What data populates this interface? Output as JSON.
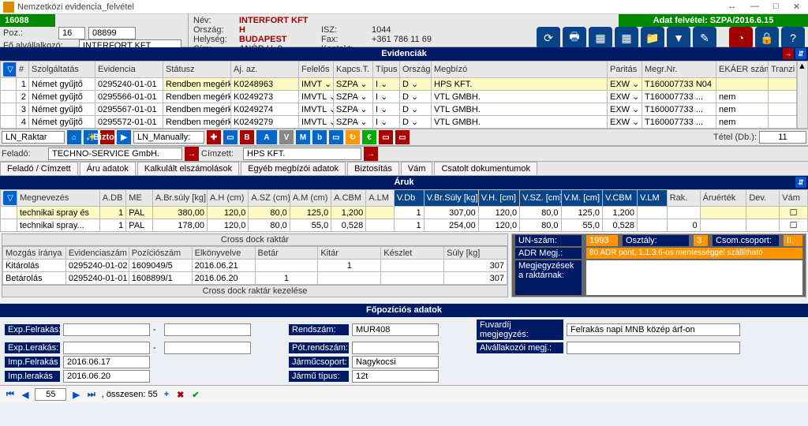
{
  "window": {
    "title": "Nemzetközi evidencia_felvétel",
    "param": "16088",
    "min": "—",
    "max": "□",
    "close": "✕",
    "up": "↔"
  },
  "header": {
    "posLbl": "Poz.:",
    "pos1": "16",
    "pos2": "08899",
    "foLbl": "Fő alvállalkozó:",
    "fo": "INTERFORT KFT",
    "info": {
      "nev": "Név:",
      "nevV": "INTERFORT KFT",
      "orszag": "Ország:",
      "orszagV": "H",
      "isz": "ISZ:",
      "iszV": "1044",
      "hely": "Helység:",
      "helyV": "BUDAPEST",
      "fax": "Fax:",
      "faxV": "+361 786 11 69",
      "cim": "Cím:",
      "cimV": "ANÓD U. 9.",
      "kontakt": "Kontakt:",
      "kontaktV": ""
    },
    "rightGreen": "Adat felvétel: SZPA/2016.6.15"
  },
  "evid": {
    "title": "Evidenciák",
    "cols": {
      "num": "#",
      "szolg": "Szolgáltatás",
      "evid": "Evidencia",
      "stat": "Státusz",
      "aj": "Aj. az.",
      "fel": "Felelős",
      "kt": "Kapcs.T.",
      "tip": "Típus",
      "orsz": "Ország",
      "megb": "Megbízó",
      "par": "Paritás",
      "megr": "Megr.Nr.",
      "ek": "EKÁER szám",
      "tr": "Tranzi"
    },
    "rows": [
      {
        "n": "1",
        "sz": "Német gyűjtő",
        "ev": "0295240-01-01",
        "st": "Rendben megérkezi",
        "aj": "K0248963",
        "fe": "IMVT",
        "kt": "SZPA",
        "ti": "I",
        "or": "D",
        "mb": "HPS KFT.",
        "pa": "EXW",
        "mr": "T160007733 N04",
        "ek": "",
        "yh": true
      },
      {
        "n": "2",
        "sz": "Német gyűjtő",
        "ev": "0295566-01-01",
        "st": "Rendben megérkezett",
        "aj": "K0249273",
        "fe": "IMVTL",
        "kt": "SZPA",
        "ti": "I",
        "or": "D",
        "mb": "VTL GMBH.",
        "pa": "EXW",
        "mr": "T160007733 ...",
        "ek": "nem"
      },
      {
        "n": "3",
        "sz": "Német gyűjtő",
        "ev": "0295567-01-01",
        "st": "Rendben megérkezett",
        "aj": "K0249274",
        "fe": "IMVTL",
        "kt": "SZPA",
        "ti": "I",
        "or": "D",
        "mb": "VTL GMBH.",
        "pa": "EXW",
        "mr": "T160007733 ...",
        "ek": "nem"
      },
      {
        "n": "4",
        "sz": "Német gyűjtő",
        "ev": "0295572-01-01",
        "st": "Rendben megérkezett",
        "aj": "K0249279",
        "fe": "IMVTL",
        "kt": "SZPA",
        "ti": "I",
        "or": "D",
        "mb": "VTL GMBH.",
        "pa": "EXW",
        "mr": "T160007733 ...",
        "ek": "nem"
      }
    ]
  },
  "mid": {
    "ln1": "LN_Raktar",
    "biztosi": "Biztosí",
    "ln2": "LN_Manually:",
    "tetel": "Tétel (Db.):",
    "tetelV": "11",
    "feladoLbl": "Feladó:",
    "felado": "TECHNO-SERVICE GmbH.",
    "cimzettLbl": "Címzett:",
    "cimzett": "HPS KFT."
  },
  "tabs": [
    "Feladó / Címzett",
    "Áru adatok",
    "Kalkulált elszámolások",
    "Egyéb megbízói adatok",
    "Biztosítás",
    "Vám",
    "Csatolt dokumentumok"
  ],
  "aruk": {
    "title": "Áruk",
    "cols": {
      "meg": "Megnevezés",
      "adb": "A.DB",
      "me": "ME",
      "abs": "A.Br.súly [kg]",
      "ah": "A.H (cm)",
      "asz": "A.SZ (cm)",
      "am": "A.M (cm)",
      "acbm": "A.CBM",
      "alm": "A.LM",
      "vdb": "V.Db",
      "vbs": "V.Br.Súly [kg]",
      "vh": "V.H. [cm]",
      "vsz": "V.SZ. [cm]",
      "vm": "V.M. [cm]",
      "vcbm": "V.CBM",
      "vlm": "V.LM",
      "rak": "Rak.",
      "aru": "Áruérték",
      "dev": "Dev.",
      "vam": "Vám"
    },
    "rows": [
      {
        "meg": "technikai spray és",
        "adb": "1",
        "me": "PAL",
        "abs": "380,00",
        "ah": "120,0",
        "asz": "80,0",
        "am": "125,0",
        "acbm": "1,200",
        "alm": "",
        "vdb": "1",
        "vbs": "307,00",
        "vh": "120,0",
        "vsz": "80,0",
        "vm": "125,0",
        "vcbm": "1,200",
        "vlm": "",
        "rak": "",
        "aru": "",
        "dev": "",
        "vam": "☐",
        "yh": true
      },
      {
        "meg": "technikai spray...",
        "adb": "1",
        "me": "PAL",
        "abs": "178,00",
        "ah": "120,0",
        "asz": "80,0",
        "am": "55,0",
        "acbm": "0,528",
        "alm": "",
        "vdb": "1",
        "vbs": "254,00",
        "vh": "120,0",
        "vsz": "80,0",
        "vm": "55,0",
        "vcbm": "0,528",
        "vlm": "",
        "rak": "0",
        "aru": "",
        "dev": "",
        "vam": "☐"
      }
    ]
  },
  "cross": {
    "title": "Cross dock raktár",
    "cols": {
      "moz": "Mozgás iránya",
      "evsz": "Evidenciaszám",
      "poz": "Pozíciószám",
      "elk": "Elkönyvelve",
      "bet": "Betár",
      "kit": "Kitár",
      "kesz": "Készlet",
      "suly": "Súly [kg]"
    },
    "rows": [
      {
        "moz": "Kitárolás",
        "evsz": "0295240-01-02",
        "poz": "1609049/5",
        "elk": "2016.06.21",
        "bet": "",
        "kit": "1",
        "kesz": "",
        "suly": "307"
      },
      {
        "moz": "Betárolás",
        "evsz": "0295240-01-01",
        "poz": "1608899/1",
        "elk": "2016.06.20",
        "bet": "1",
        "kit": "",
        "kesz": "",
        "suly": "307"
      }
    ],
    "kez": "Cross dock raktár kezelése"
  },
  "un": {
    "unLbl": "UN-szám:",
    "un": "1993",
    "oszLbl": "Osztály:",
    "osz": "3",
    "csLbl": "Csom.csoport:",
    "cs": "II.",
    "adrLbl": "ADR Megj.:",
    "adr": "80 ADR pont, 1.1.3.6-os mentességgel szállítható",
    "megjLbl": "Megjegyzések a raktárnak:"
  },
  "fop": {
    "title": "Főpozíciós adatok",
    "expFel": "Exp.Felrakás:",
    "expLer": "Exp.Lerakás:",
    "impFel": "Imp.Felrakás",
    "impLer": "Imp.lerakás",
    "impFelV": "2016.06.17",
    "impLerV": "2016.06.20",
    "rend": "Rendszám:",
    "rendV": "MUR408",
    "pot": "Pót.rendszám:",
    "jcs": "Járműcsoport:",
    "jcsV": "Nagykocsi",
    "jt": "Jármű típus:",
    "jtV": "12t",
    "fuv": "Fuvardíj megjegyzés:",
    "fuvV": "Felrakás napi MNB közép árf-on",
    "alv": "Alvállakozói megj.:"
  },
  "nav": {
    "rec": "55",
    "total": ", összesen: 55"
  }
}
